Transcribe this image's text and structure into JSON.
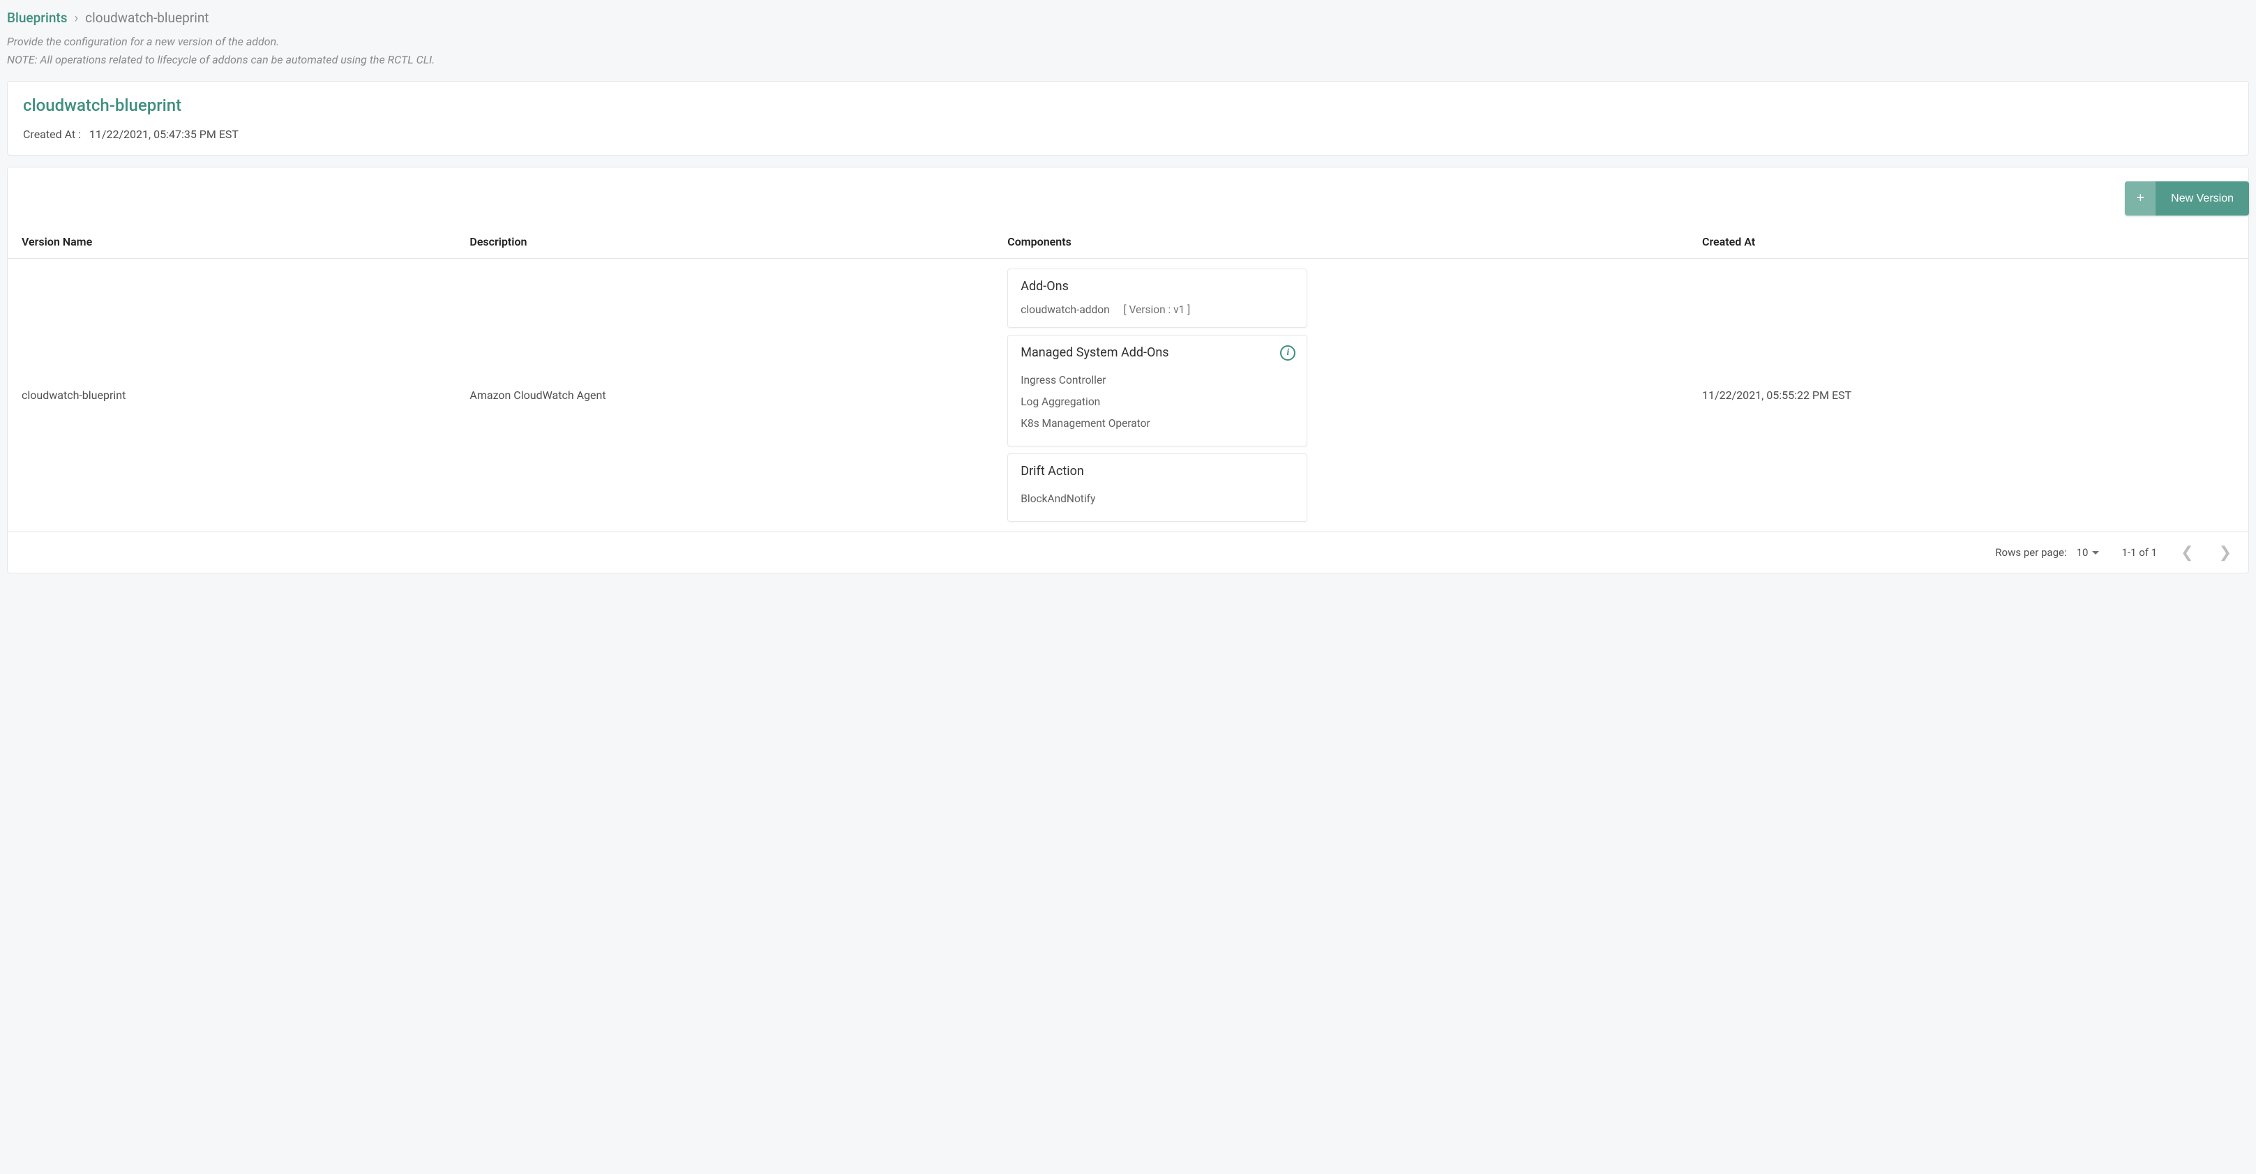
{
  "breadcrumb": {
    "root": "Blueprints",
    "separator": "›",
    "current": "cloudwatch-blueprint"
  },
  "subtitle": {
    "line1": "Provide the configuration for a new version of the addon.",
    "line2": "NOTE: All operations related to lifecycle of addons can be automated using the RCTL CLI."
  },
  "header": {
    "title": "cloudwatch-blueprint",
    "created_label": "Created At :",
    "created_value": "11/22/2021, 05:47:35 PM EST"
  },
  "actions": {
    "new_version_label": "New Version",
    "plus": "+"
  },
  "table": {
    "columns": {
      "version_name": "Version Name",
      "description": "Description",
      "components": "Components",
      "created_at": "Created At"
    },
    "row": {
      "version_name": "cloudwatch-blueprint",
      "description": "Amazon CloudWatch Agent",
      "created_at": "11/22/2021, 05:55:22 PM EST",
      "components": {
        "addons": {
          "title": "Add-Ons",
          "name": "cloudwatch-addon",
          "version_label": "[ Version : v1 ]"
        },
        "managed": {
          "title": "Managed System Add-Ons",
          "items": {
            "0": "Ingress Controller",
            "1": "Log Aggregation",
            "2": "K8s Management Operator"
          }
        },
        "drift": {
          "title": "Drift Action",
          "value": "BlockAndNotify"
        }
      }
    }
  },
  "pagination": {
    "rows_label": "Rows per page:",
    "rows_value": "10",
    "range": "1-1 of 1"
  }
}
